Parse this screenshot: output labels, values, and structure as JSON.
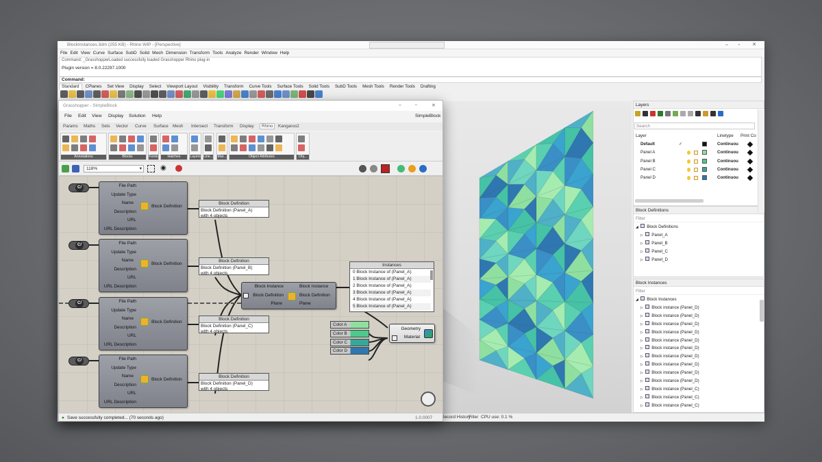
{
  "rhino": {
    "title": "BlockInstances.3dm (255 KB) - Rhino WIP - [Perspective]",
    "menu": [
      "File",
      "Edit",
      "View",
      "Curve",
      "Surface",
      "SubD",
      "Solid",
      "Mesh",
      "Dimension",
      "Transform",
      "Tools",
      "Analyze",
      "Render",
      "Window",
      "Help"
    ],
    "cmd_history_line": "Command: _GrasshopperLoaded successfully loaded Grasshopper Rhino plug-in",
    "plugin_version": "Plugin version = 8.0.22297.1000",
    "command_label": "Command:",
    "tabs": [
      "Standard",
      "CPlanes",
      "Set View",
      "Display",
      "Select",
      "Viewport Layout",
      "Visibility",
      "Transform",
      "Curve Tools",
      "Surface Tools",
      "Solid Tools",
      "SubD Tools",
      "Mesh Tools",
      "Render Tools",
      "Drafting"
    ],
    "status_left": "Record History",
    "status_filter": "Filter",
    "status_cpu": "CPU use: 0.1 %"
  },
  "layers": {
    "title": "Layers",
    "search_placeholder": "Search",
    "col_layer": "Layer",
    "col_linetype": "Linetype",
    "col_print": "Print Co",
    "rows": [
      {
        "name": "Default",
        "linetype": "Continuou",
        "color": "#111111"
      },
      {
        "name": "Panel A",
        "linetype": "Continuou",
        "color": "#8fe0a0"
      },
      {
        "name": "Panel B",
        "linetype": "Continuou",
        "color": "#4ec98c"
      },
      {
        "name": "Panel C",
        "linetype": "Continuou",
        "color": "#38a79a"
      },
      {
        "name": "Panel D",
        "linetype": "Continuou",
        "color": "#2f77b0"
      }
    ]
  },
  "block_defs": {
    "title": "Block Definitions",
    "filter": "Filter",
    "root": "Block Definitions",
    "items": [
      "Panel_A",
      "Panel_B",
      "Panel_C",
      "Panel_D"
    ]
  },
  "block_inst": {
    "title": "Block Instances",
    "filter": "Filter",
    "root": "Block Instances",
    "items": [
      "Block instance (Panel_D)",
      "Block instance (Panel_D)",
      "Block instance (Panel_D)",
      "Block instance (Panel_D)",
      "Block instance (Panel_D)",
      "Block instance (Panel_D)",
      "Block instance (Panel_D)",
      "Block instance (Panel_D)",
      "Block instance (Panel_D)",
      "Block instance (Panel_D)",
      "Block instance (Panel_C)",
      "Block instance (Panel_C)",
      "Block instance (Panel_C)"
    ]
  },
  "gh": {
    "title": "Grasshopper - SimpleBlock",
    "doc_name": "SimpleBlock",
    "menu": [
      "File",
      "Edit",
      "View",
      "Display",
      "Solution",
      "Help"
    ],
    "tabs": [
      "Params",
      "Maths",
      "Sets",
      "Vector",
      "Curve",
      "Surface",
      "Mesh",
      "Intersect",
      "Transform",
      "Display",
      "Rhino",
      "Kangaroo2"
    ],
    "ribbon_groups": [
      "Annotations",
      "Blocks",
      "Fonts",
      "Hatches",
      "Layers",
      "Line...",
      "Mat...",
      "Object Attributes",
      "Obj..."
    ],
    "zoom": "118%",
    "status": "Save successfully completed... (70 seconds ago)",
    "version": "1.0.0007",
    "bd_inputs": [
      "File Path",
      "Update Type",
      "Name",
      "Description",
      "URL",
      "URL Description"
    ],
    "bd_output": "Block Definition",
    "bd_panel_title": "Block Definition",
    "bd_panels": [
      "Block Definition (Panel_A)",
      "Block Definition (Panel_B)",
      "Block Definition (Panel_C)",
      "Block Definition (Panel_D)"
    ],
    "bd_panel_sub": "with 4 objects",
    "bi_inputs": [
      "Block Instance",
      "Block Definition",
      "Plane"
    ],
    "bi_outputs": [
      "Block Instance",
      "Block Definition",
      "Plane"
    ],
    "inst_title": "Instances",
    "inst_rows": [
      "0 Block Instance of (Panel_A)",
      "1 Block Instance of (Panel_A)",
      "2 Block Instance of (Panel_A)",
      "3 Block Instance of (Panel_A)",
      "4 Block Instance of (Panel_A)",
      "5 Block Instance of (Panel_A)"
    ],
    "colors": [
      {
        "label": "Color A",
        "hex": "#8fe0a0"
      },
      {
        "label": "Color B",
        "hex": "#4ec98c"
      },
      {
        "label": "Color C",
        "hex": "#38a79a"
      },
      {
        "label": "Color D",
        "hex": "#2f77b0"
      }
    ],
    "mat_inputs": [
      "Geometry",
      "Material"
    ],
    "cb_label": "C/"
  }
}
